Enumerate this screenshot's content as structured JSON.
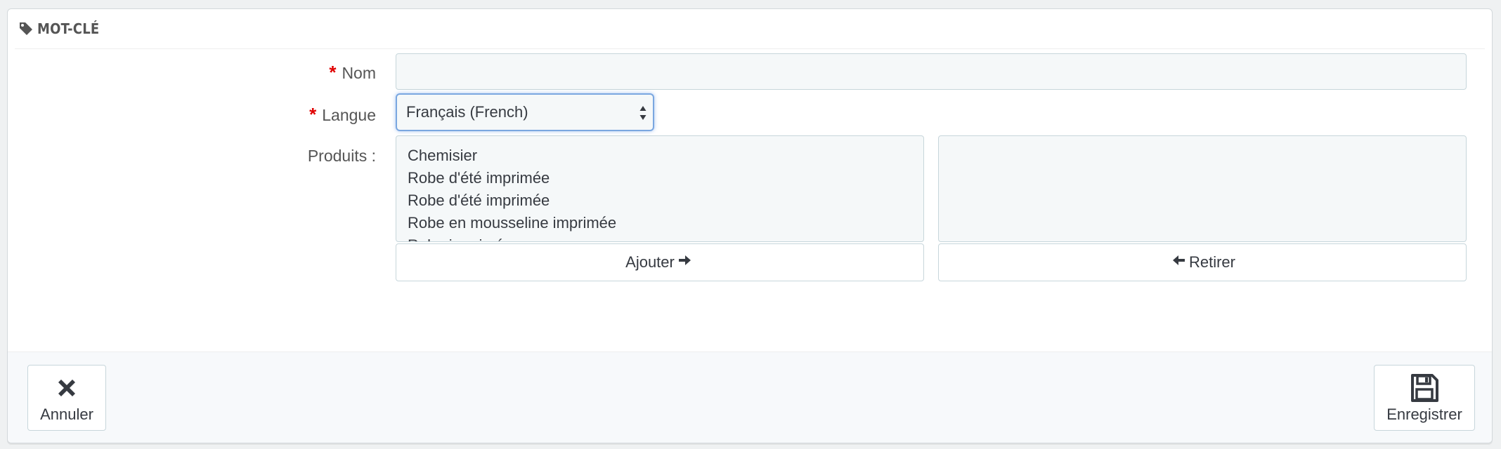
{
  "panel": {
    "title": "MOT-CLÉ",
    "title_icon": "tag-icon"
  },
  "form": {
    "name": {
      "required_mark": "*",
      "label": "Nom",
      "value": ""
    },
    "language": {
      "required_mark": "*",
      "label": "Langue",
      "selected": "Français (French)"
    },
    "products": {
      "label": "Produits :",
      "available": [
        "Chemisier",
        "Robe d'été imprimée",
        "Robe d'été imprimée",
        "Robe en mousseline imprimée",
        "Robe imprimée"
      ],
      "selected": [],
      "add_label": "Ajouter",
      "add_icon": "arrow-right-icon",
      "remove_label": "Retirer",
      "remove_icon": "arrow-left-icon"
    }
  },
  "footer": {
    "cancel_label": "Annuler",
    "cancel_icon": "close-icon",
    "save_label": "Enregistrer",
    "save_icon": "floppy-disk-icon"
  },
  "colors": {
    "required": "#e00000",
    "focus_border": "#7aa7e0",
    "input_bg": "#f5f8f9"
  }
}
